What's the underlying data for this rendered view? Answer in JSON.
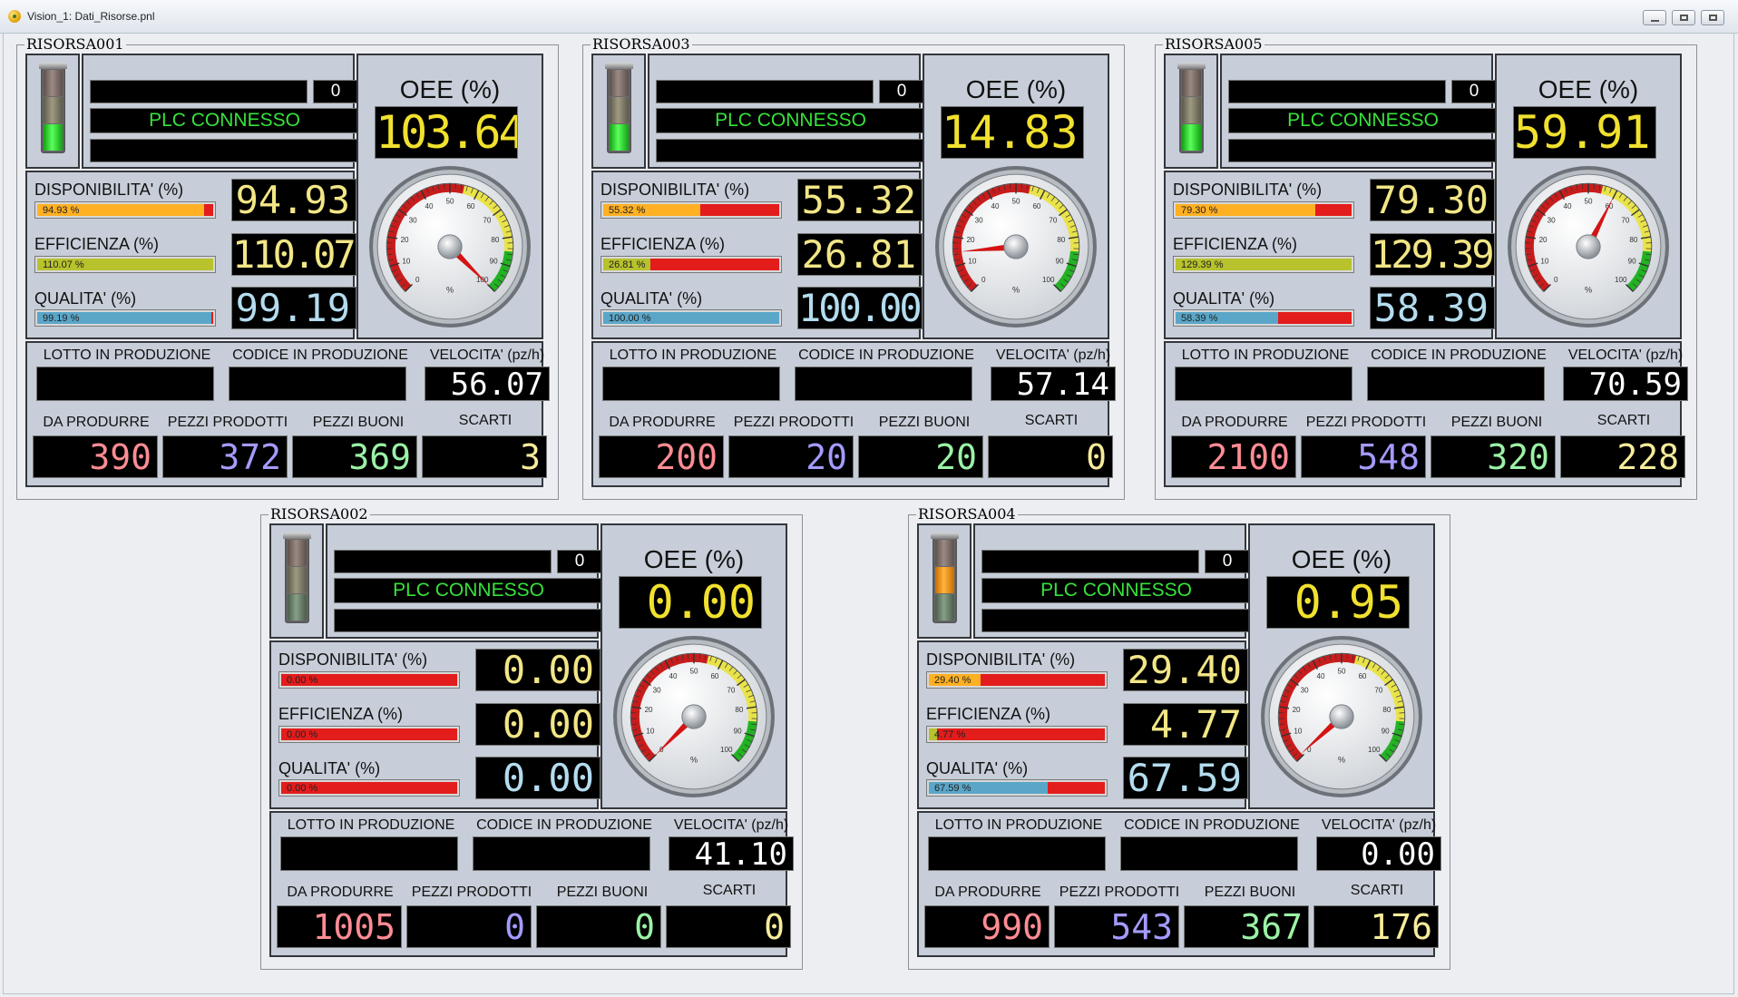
{
  "window": {
    "title": "Vision_1: Dati_Risorse.pnl"
  },
  "labels": {
    "oee": "OEE (%)",
    "disponibilita": "DISPONIBILITA' (%)",
    "efficienza": "EFFICIENZA (%)",
    "qualita": "QUALITA' (%)",
    "lotto": "LOTTO IN PRODUZIONE",
    "codice": "CODICE IN PRODUZIONE",
    "velocita": "VELOCITA' (pz/h)",
    "da_produrre": "DA PRODURRE",
    "pezzi_prodotti": "PEZZI PRODOTTI",
    "pezzi_buoni": "PEZZI BUONI",
    "scarti": "SCARTI",
    "gauge_unit": "%"
  },
  "gauge_ticks": [
    "0",
    "10",
    "20",
    "30",
    "40",
    "50",
    "60",
    "70",
    "80",
    "90",
    "100"
  ],
  "colors": {
    "bar_red": "#e31c1c",
    "disp_fill": "#ffb023",
    "eff_fill": "#b7c22c",
    "qual_fill": "#5aa6c9",
    "plc_green": "#37e23b",
    "oee_yellow": "#f1e12e"
  },
  "resources": [
    {
      "name": "RISORSA001",
      "light": "green",
      "status": {
        "count": "0",
        "plc": "PLC CONNESSO"
      },
      "oee": {
        "display": "103.64",
        "value": 103.64
      },
      "disponibilita": {
        "display": "94.93",
        "bar_label": "94.93 %",
        "value": 94.93
      },
      "efficienza": {
        "display": "110.07",
        "bar_label": "110.07 %",
        "value": 110.07
      },
      "qualita": {
        "display": "99.19",
        "bar_label": "99.19 %",
        "value": 99.19
      },
      "velocita": "56.07",
      "da_produrre": "390",
      "pezzi_prodotti": "372",
      "pezzi_buoni": "369",
      "scarti": "3"
    },
    {
      "name": "RISORSA003",
      "light": "green",
      "status": {
        "count": "0",
        "plc": "PLC CONNESSO"
      },
      "oee": {
        "display": "14.83",
        "value": 14.83
      },
      "disponibilita": {
        "display": "55.32",
        "bar_label": "55.32 %",
        "value": 55.32
      },
      "efficienza": {
        "display": "26.81",
        "bar_label": "26.81 %",
        "value": 26.81
      },
      "qualita": {
        "display": "100.00",
        "bar_label": "100.00 %",
        "value": 100.0
      },
      "velocita": "57.14",
      "da_produrre": "200",
      "pezzi_prodotti": "20",
      "pezzi_buoni": "20",
      "scarti": "0"
    },
    {
      "name": "RISORSA005",
      "light": "green",
      "status": {
        "count": "0",
        "plc": "PLC CONNESSO"
      },
      "oee": {
        "display": "59.91",
        "value": 59.91
      },
      "disponibilita": {
        "display": "79.30",
        "bar_label": "79.30 %",
        "value": 79.3
      },
      "efficienza": {
        "display": "129.39",
        "bar_label": "129.39 %",
        "value": 129.39
      },
      "qualita": {
        "display": "58.39",
        "bar_label": "58.39 %",
        "value": 58.39
      },
      "velocita": "70.59",
      "da_produrre": "2100",
      "pezzi_prodotti": "548",
      "pezzi_buoni": "320",
      "scarti": "228"
    },
    {
      "name": "RISORSA002",
      "light": "off",
      "status": {
        "count": "0",
        "plc": "PLC CONNESSO"
      },
      "oee": {
        "display": "0.00",
        "value": 0.0
      },
      "disponibilita": {
        "display": "0.00",
        "bar_label": "0.00 %",
        "value": 0.0
      },
      "efficienza": {
        "display": "0.00",
        "bar_label": "0.00 %",
        "value": 0.0
      },
      "qualita": {
        "display": "0.00",
        "bar_label": "0.00 %",
        "value": 0.0
      },
      "velocita": "41.10",
      "da_produrre": "1005",
      "pezzi_prodotti": "0",
      "pezzi_buoni": "0",
      "scarti": "0"
    },
    {
      "name": "RISORSA004",
      "light": "amber",
      "status": {
        "count": "0",
        "plc": "PLC CONNESSO"
      },
      "oee": {
        "display": "0.95",
        "value": 0.95
      },
      "disponibilita": {
        "display": "29.40",
        "bar_label": "29.40 %",
        "value": 29.4
      },
      "efficienza": {
        "display": "4.77",
        "bar_label": "4.77 %",
        "value": 4.77
      },
      "qualita": {
        "display": "67.59",
        "bar_label": "67.59 %",
        "value": 67.59
      },
      "velocita": "0.00",
      "da_produrre": "990",
      "pezzi_prodotti": "543",
      "pezzi_buoni": "367",
      "scarti": "176"
    }
  ]
}
